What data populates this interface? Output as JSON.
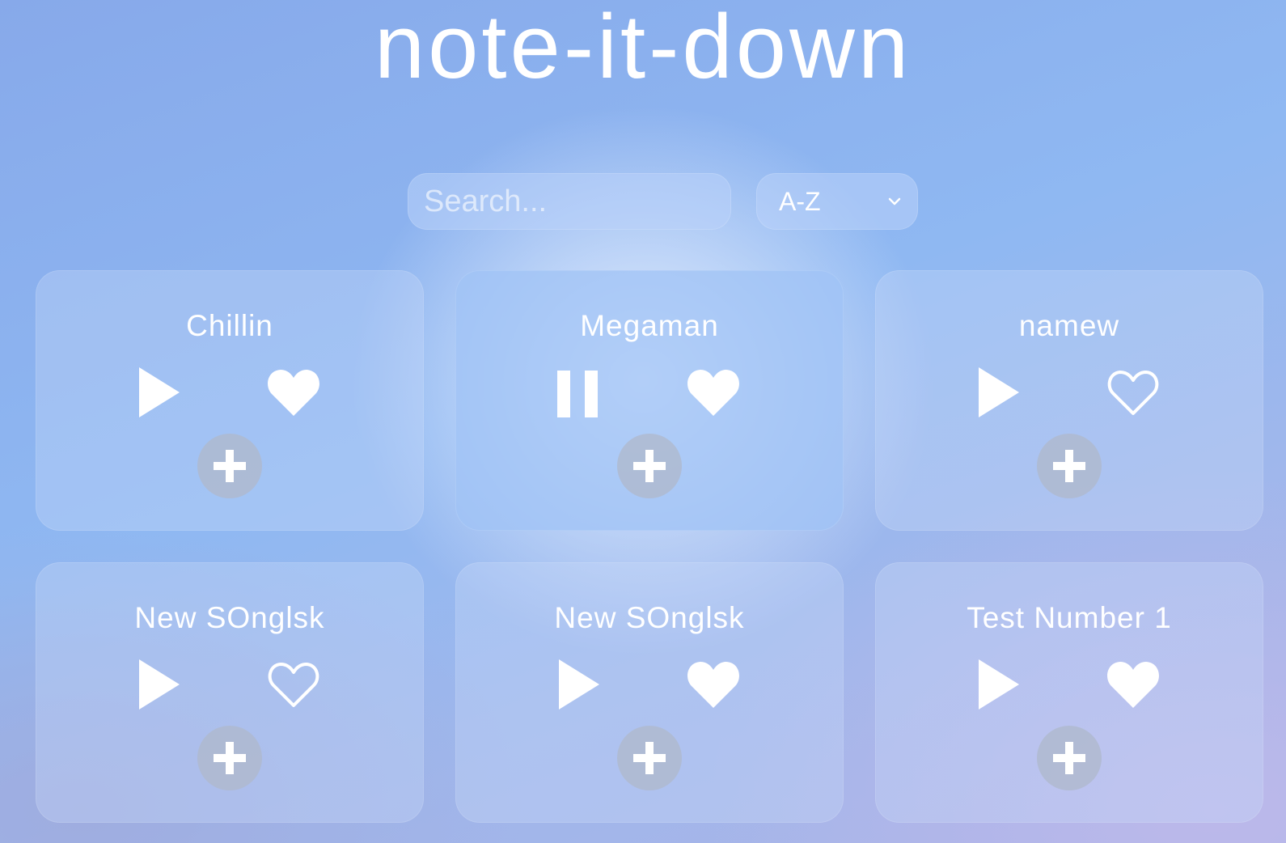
{
  "app": {
    "title": "note-it-down"
  },
  "search": {
    "placeholder": "Search...",
    "value": ""
  },
  "sort": {
    "selected": "A-Z"
  },
  "songs": [
    {
      "name": "Chillin",
      "playing": false,
      "favorite": true
    },
    {
      "name": "Megaman",
      "playing": true,
      "favorite": true
    },
    {
      "name": "namew",
      "playing": false,
      "favorite": false
    },
    {
      "name": "New SOnglsk",
      "playing": false,
      "favorite": false
    },
    {
      "name": "New SOnglsk",
      "playing": false,
      "favorite": true
    },
    {
      "name": "Test Number 1",
      "playing": false,
      "favorite": true
    }
  ],
  "icons": {
    "play": "play-icon",
    "pause": "pause-icon",
    "favorite": "heart-filled-icon",
    "not_favorite": "heart-outline-icon",
    "add": "plus-icon",
    "dropdown": "chevron-down-icon"
  },
  "colors": {
    "text": "#ffffff",
    "add_button": "#b4bccd"
  }
}
